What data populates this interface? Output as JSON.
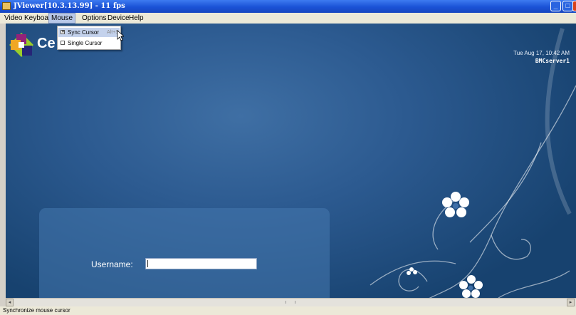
{
  "window": {
    "title": "JViewer[10.3.13.99] - 11 fps",
    "buttons": {
      "minimize": "_",
      "maximize": "□",
      "close": "x"
    }
  },
  "menubar": {
    "items": [
      {
        "label": "Video",
        "active": false
      },
      {
        "label": "Keyboard",
        "active": false
      },
      {
        "label": "Mouse",
        "active": true
      },
      {
        "label": "Options",
        "active": false
      },
      {
        "label": "Device",
        "active": false
      },
      {
        "label": "Help",
        "active": false
      }
    ]
  },
  "mouse_menu": {
    "items": [
      {
        "label": "Sync Cursor",
        "checked": true,
        "shortcut": "Alt+S"
      },
      {
        "label": "Single Cursor",
        "checked": false,
        "shortcut": ""
      }
    ]
  },
  "remote_screen": {
    "logo_text": "Ce",
    "clock": "Tue Aug 17, 10:42 AM",
    "hostname": "BMCserver1",
    "username_label": "Username:",
    "username_value": "",
    "colors": {
      "background": "#2c5a90",
      "panel": "#4678af"
    }
  },
  "scrollbar": {
    "left_arrow": "◂",
    "right_arrow": "▸"
  },
  "status_bar": {
    "text": "Synchronize mouse cursor"
  }
}
